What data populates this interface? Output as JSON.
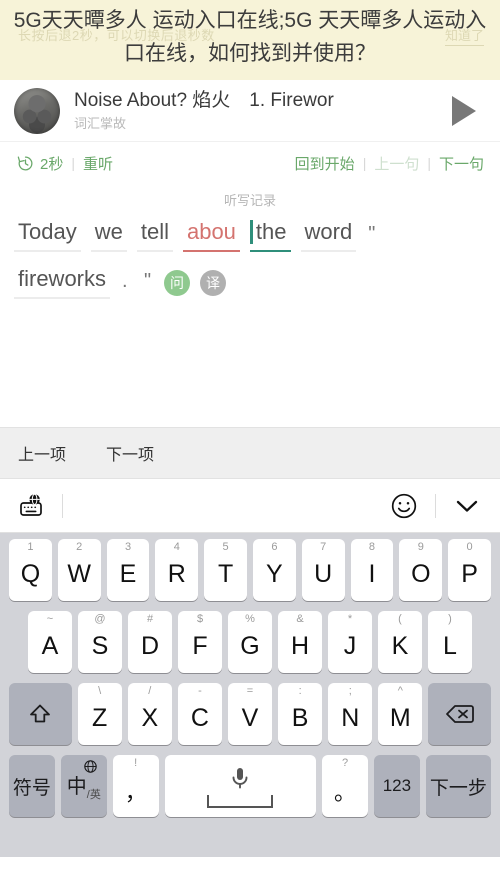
{
  "banner": {
    "title": "5G天天曋多人 运动入口在线;5G 天天曋多人运动入口在线，如何找到并使用？",
    "hint_left": "长按后退2秒，可以切换后退秒数",
    "hint_right": "知道了"
  },
  "player": {
    "title": "Noise About? 焰火　1. Firewor",
    "subtitle": "词汇掌故",
    "play_icon": "play-triangle-icon",
    "avatar_icon": "podcast-avatar"
  },
  "controls": {
    "rewind_icon": "rewind-clock-icon",
    "rewind_label": "2秒",
    "separator": "|",
    "replay_label": "重听",
    "back_to_start_label": "回到开始",
    "prev_sentence_label": "上一句",
    "next_sentence_label": "下一句",
    "accent_color": "#6aa86a",
    "disabled_color": "#cfe0cf"
  },
  "dictation": {
    "section_label": "听写记录",
    "line1": [
      {
        "text": "Today",
        "state": "normal"
      },
      {
        "text": "we",
        "state": "normal"
      },
      {
        "text": "tell",
        "state": "normal"
      },
      {
        "text": "abou",
        "state": "wrong"
      },
      {
        "text": "the",
        "state": "active"
      },
      {
        "text": "word",
        "state": "normal"
      },
      {
        "text": "\"",
        "state": "punct"
      }
    ],
    "line2": [
      {
        "text": "fireworks",
        "state": "normal"
      },
      {
        "text": ".",
        "state": "punct"
      },
      {
        "text": "\"",
        "state": "punct"
      }
    ],
    "badges": [
      {
        "label": "问",
        "kind": "ask",
        "color": "#8fc98f"
      },
      {
        "label": "译",
        "kind": "trans",
        "color": "#b0b0b0"
      }
    ],
    "wrong_color": "#d4736f",
    "cursor_color": "#2f8f7b"
  },
  "itemnav": {
    "prev_item_label": "上一项",
    "next_item_label": "下一项"
  },
  "kb_toolbar": {
    "globe_keyboard_icon": "globe-keyboard-icon",
    "emoji_icon": "smiley-face-icon",
    "collapse_icon": "chevron-down-icon"
  },
  "keyboard": {
    "row1": [
      {
        "sup": "1",
        "main": "Q"
      },
      {
        "sup": "2",
        "main": "W"
      },
      {
        "sup": "3",
        "main": "E"
      },
      {
        "sup": "4",
        "main": "R"
      },
      {
        "sup": "5",
        "main": "T"
      },
      {
        "sup": "6",
        "main": "Y"
      },
      {
        "sup": "7",
        "main": "U"
      },
      {
        "sup": "8",
        "main": "I"
      },
      {
        "sup": "9",
        "main": "O"
      },
      {
        "sup": "0",
        "main": "P"
      }
    ],
    "row2": [
      {
        "sup": "~",
        "main": "A"
      },
      {
        "sup": "@",
        "main": "S"
      },
      {
        "sup": "#",
        "main": "D"
      },
      {
        "sup": "$",
        "main": "F"
      },
      {
        "sup": "%",
        "main": "G"
      },
      {
        "sup": "&",
        "main": "H"
      },
      {
        "sup": "*",
        "main": "J"
      },
      {
        "sup": "(",
        "main": "K"
      },
      {
        "sup": ")",
        "main": "L"
      }
    ],
    "row3": [
      {
        "sup": "\\",
        "main": "Z"
      },
      {
        "sup": "/",
        "main": "X"
      },
      {
        "sup": "-",
        "main": "C"
      },
      {
        "sup": "=",
        "main": "V"
      },
      {
        "sup": ":",
        "main": "B"
      },
      {
        "sup": ";",
        "main": "N"
      },
      {
        "sup": "^",
        "main": "M"
      }
    ],
    "shift_icon": "shift-up-arrow-icon",
    "backspace_icon": "backspace-delete-icon",
    "row4": {
      "symbols_label": "符号",
      "lang_label": "中",
      "lang_sub": "/英",
      "lang_globe_icon": "globe-icon",
      "comma_sup": "!",
      "comma_main": "，",
      "space_icon": "microphone-icon",
      "period_sup": "?",
      "period_main": "。",
      "numbers_label": "123",
      "next_label": "下一步"
    }
  }
}
